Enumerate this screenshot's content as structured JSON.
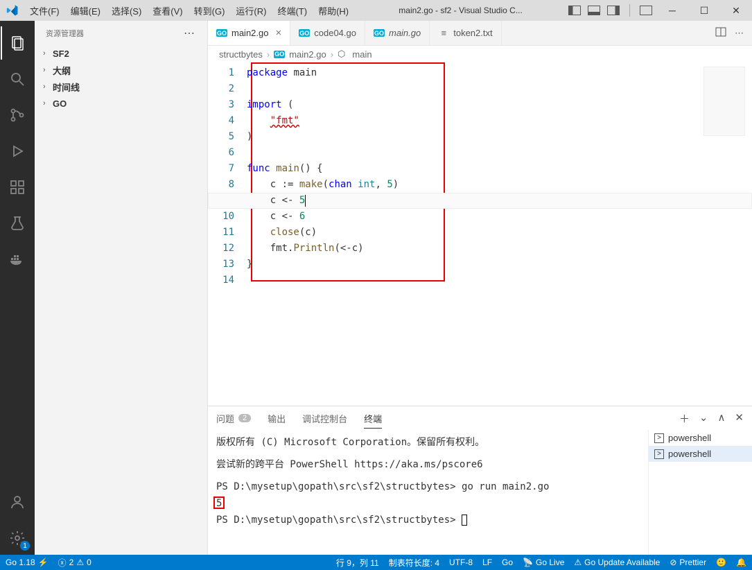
{
  "title": "main2.go - sf2 - Visual Studio C...",
  "menu": [
    "文件(F)",
    "编辑(E)",
    "选择(S)",
    "查看(V)",
    "转到(G)",
    "运行(R)",
    "终端(T)",
    "帮助(H)"
  ],
  "sidebar": {
    "header": "资源管理器",
    "items": [
      "SF2",
      "大纲",
      "时间线",
      "GO"
    ]
  },
  "tabs": [
    {
      "name": "main2.go",
      "type": "go",
      "active": true,
      "closable": true
    },
    {
      "name": "code04.go",
      "type": "go"
    },
    {
      "name": "main.go",
      "type": "go",
      "italic": true
    },
    {
      "name": "token2.txt",
      "type": "txt"
    }
  ],
  "breadcrumb": {
    "root": "structbytes",
    "file": "main2.go",
    "symbol": "main"
  },
  "code": {
    "lines": 14,
    "l1_kw": "package",
    "l1_id": "main",
    "l3_kw": "import",
    "l3_paren": " (",
    "l4_str": "\"fmt\"",
    "l5": ")",
    "l7_kw": "func",
    "l7_fn": "main",
    "l7_rest": "() {",
    "l8_pre": "    c := ",
    "l8_make": "make",
    "l8_p1": "(",
    "l8_chan": "chan",
    "l8_sp": " ",
    "l8_int": "int",
    "l8_comma": ", ",
    "l8_num": "5",
    "l8_p2": ")",
    "l9_pre": "    c <- ",
    "l9_num": "5",
    "l10_pre": "    c <- ",
    "l10_num": "6",
    "l11_pre": "    ",
    "l11_fn": "close",
    "l11_rest": "(c)",
    "l12_pre": "    fmt.",
    "l12_fn": "Println",
    "l12_rest": "(<-c)",
    "l13": "}"
  },
  "terminal": {
    "tabs": {
      "problems": "问题",
      "problems_count": "2",
      "output": "输出",
      "debug": "调试控制台",
      "terminal": "终端"
    },
    "line1": "版权所有 (C) Microsoft Corporation。保留所有权利。",
    "line2": "尝试新的跨平台 PowerShell https://aka.ms/pscore6",
    "prompt1": "PS D:\\mysetup\\gopath\\src\\sf2\\structbytes> ",
    "cmd1": "go run main2.go",
    "out1": "5",
    "prompt2": "PS D:\\mysetup\\gopath\\src\\sf2\\structbytes> ",
    "side": [
      "powershell",
      "powershell"
    ]
  },
  "status": {
    "go": "Go 1.18",
    "errors": "2",
    "warnings": "0",
    "line_col": "行 9，列 11",
    "tabsize": "制表符长度: 4",
    "encoding": "UTF-8",
    "eol": "LF",
    "lang": "Go",
    "golive": "Go Live",
    "goupdate": "Go Update Available",
    "prettier": "Prettier"
  }
}
